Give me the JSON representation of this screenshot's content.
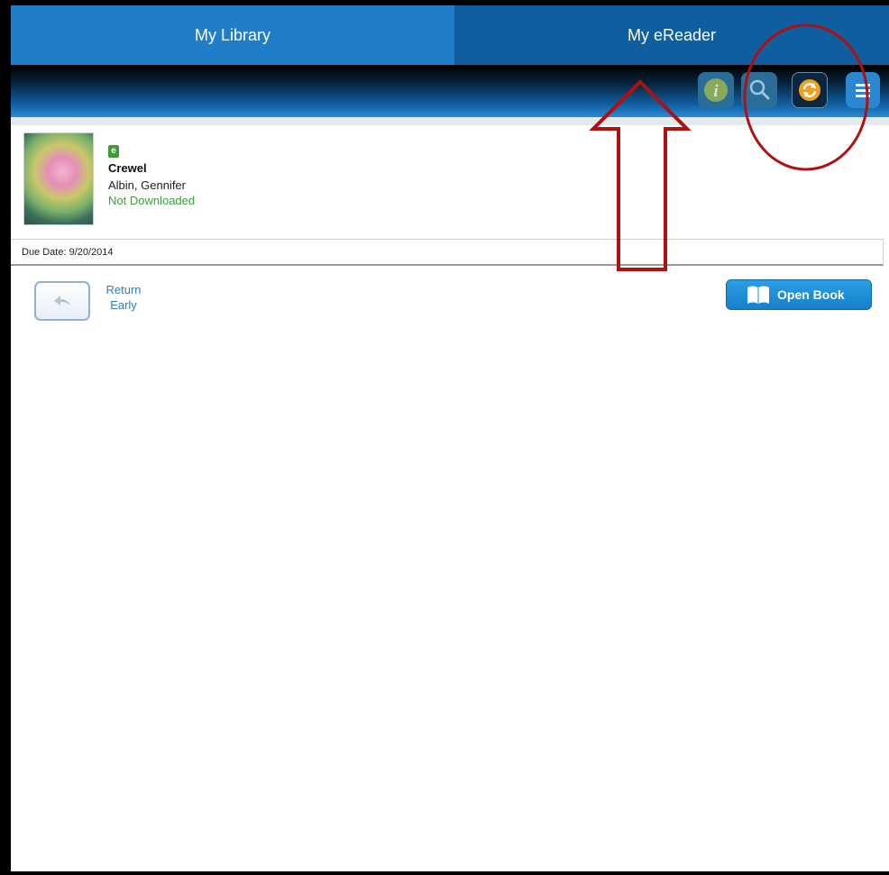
{
  "tabs": {
    "library": "My Library",
    "ereader": "My eReader"
  },
  "toolbar": {
    "icons": [
      "info-icon",
      "search-icon",
      "sync-icon",
      "menu-icon"
    ]
  },
  "book": {
    "format_icon": "e",
    "title": "Crewel",
    "author": "Albin, Gennifer",
    "status": "Not Downloaded"
  },
  "due": {
    "label": "Due Date: 9/20/2014"
  },
  "actions": {
    "return_line1": "Return",
    "return_line2": "Early",
    "open_book": "Open Book"
  },
  "colors": {
    "tab_library": "#1f7ec7",
    "tab_ereader": "#0f5fa0",
    "status_green": "#3aa03a",
    "link_blue": "#2a7fc0",
    "annotation_red": "#b01010",
    "sync_orange": "#f0a020"
  }
}
